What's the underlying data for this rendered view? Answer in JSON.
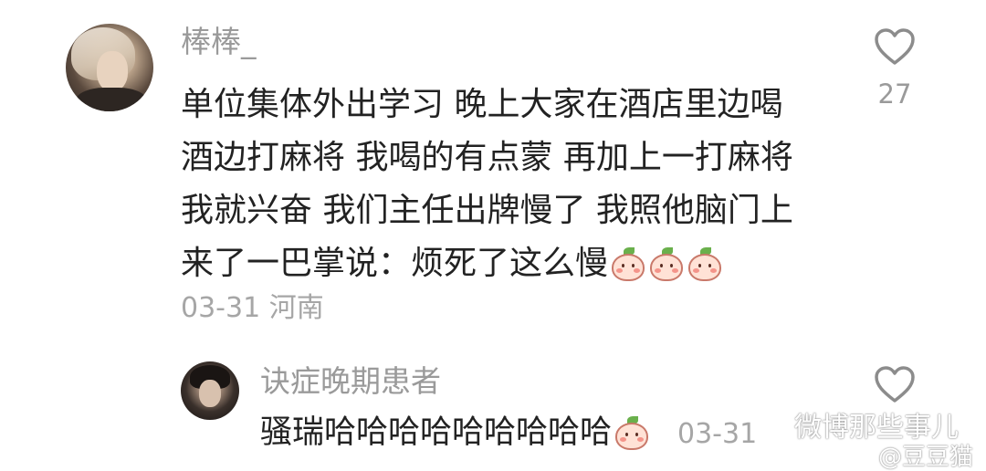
{
  "comment": {
    "username": "棒棒_",
    "lines": [
      "单位集体外出学习 晚上大家在酒店里边喝",
      "酒边打麻将 我喝的有点蒙 再加上一打麻将",
      "我就兴奋 我们主任出牌慢了 我照他脑门上",
      "来了一巴掌说：烦死了这么慢"
    ],
    "emoji_icons": [
      "peach-emoji-icon",
      "peach-emoji-icon",
      "peach-emoji-icon"
    ],
    "date": "03-31",
    "location": "河南",
    "likes": "27"
  },
  "reply": {
    "username": "诀症晚期患者",
    "text": "骚瑞哈哈哈哈哈哈哈哈哈",
    "emoji_icon": "peach-emoji-icon",
    "date": "03-31"
  },
  "watermark": {
    "main": "微博那些事儿",
    "sub": "@豆豆猫"
  },
  "colors": {
    "username": "#9a9a9a",
    "text": "#222222",
    "meta": "#a6a6a6",
    "heart_outline": "#8c8c8c"
  }
}
